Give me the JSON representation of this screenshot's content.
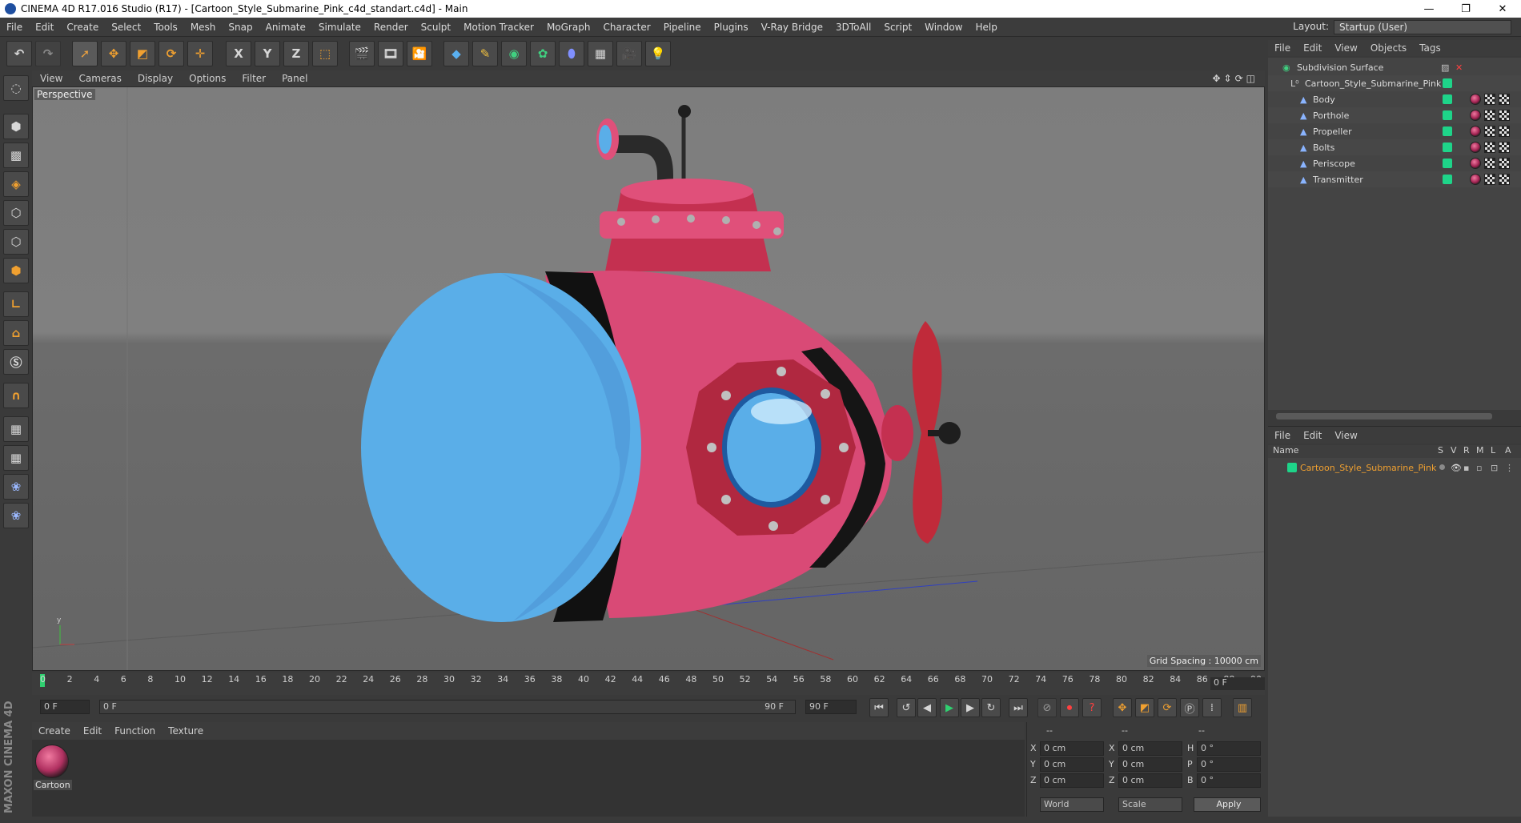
{
  "window": {
    "title": "CINEMA 4D R17.016 Studio (R17) - [Cartoon_Style_Submarine_Pink_c4d_standart.c4d] - Main",
    "minimize": "—",
    "maximize": "❐",
    "close": "✕"
  },
  "menubar": [
    "File",
    "Edit",
    "Create",
    "Select",
    "Tools",
    "Mesh",
    "Snap",
    "Animate",
    "Simulate",
    "Render",
    "Sculpt",
    "Motion Tracker",
    "MoGraph",
    "Character",
    "Pipeline",
    "Plugins",
    "V-Ray Bridge",
    "3DToAll",
    "Script",
    "Window",
    "Help"
  ],
  "layout": {
    "label": "Layout:",
    "value": "Startup (User)"
  },
  "toolbar": {
    "axis_x": "X",
    "axis_y": "Y",
    "axis_z": "Z"
  },
  "viewport": {
    "menu": [
      "View",
      "Cameras",
      "Display",
      "Options",
      "Filter",
      "Panel"
    ],
    "label": "Perspective",
    "grid_spacing": "Grid Spacing : 10000 cm"
  },
  "timeline": {
    "ticks": [
      "0",
      "2",
      "4",
      "6",
      "8",
      "10",
      "12",
      "14",
      "16",
      "18",
      "20",
      "22",
      "24",
      "26",
      "28",
      "30",
      "32",
      "34",
      "36",
      "38",
      "40",
      "42",
      "44",
      "46",
      "48",
      "50",
      "52",
      "54",
      "56",
      "58",
      "60",
      "62",
      "64",
      "66",
      "68",
      "70",
      "72",
      "74",
      "76",
      "78",
      "80",
      "82",
      "84",
      "86",
      "88",
      "90"
    ],
    "current_frame": "0 F",
    "start_field": "0 F",
    "range_start": "0 F",
    "range_end": "90 F",
    "end_field": "90 F"
  },
  "material_manager": {
    "menu": [
      "Create",
      "Edit",
      "Function",
      "Texture"
    ],
    "material_name": "Cartoon"
  },
  "brand": "MAXON CINEMA 4D",
  "coordinates": {
    "header1": "--",
    "header2": "--",
    "header3": "--",
    "rows": [
      {
        "a": "X",
        "av": "0 cm",
        "b": "X",
        "bv": "0 cm",
        "c": "H",
        "cv": "0 °"
      },
      {
        "a": "Y",
        "av": "0 cm",
        "b": "Y",
        "bv": "0 cm",
        "c": "P",
        "cv": "0 °"
      },
      {
        "a": "Z",
        "av": "0 cm",
        "b": "Z",
        "bv": "0 cm",
        "c": "B",
        "cv": "0 °"
      }
    ],
    "world": "World",
    "scale": "Scale",
    "apply": "Apply"
  },
  "object_manager": {
    "menu": [
      "File",
      "Edit",
      "View",
      "Objects",
      "Tags"
    ],
    "objects": [
      {
        "name": "Subdivision Surface",
        "level": 0
      },
      {
        "name": "Cartoon_Style_Submarine_Pink",
        "level": 1
      },
      {
        "name": "Body",
        "level": 2
      },
      {
        "name": "Porthole",
        "level": 2
      },
      {
        "name": "Propeller",
        "level": 2
      },
      {
        "name": "Bolts",
        "level": 2
      },
      {
        "name": "Periscope",
        "level": 2
      },
      {
        "name": "Transmitter",
        "level": 2
      }
    ]
  },
  "layer_manager": {
    "menu": [
      "File",
      "Edit",
      "View"
    ],
    "columns": [
      "Name",
      "S",
      "V",
      "R",
      "M",
      "L",
      "A"
    ],
    "layers": [
      {
        "name": "Cartoon_Style_Submarine_Pink"
      }
    ]
  },
  "colors": {
    "accent_green": "#1ed489",
    "layer_name": "#f0a030",
    "submarine_pink": "#e0507a",
    "submarine_blue": "#5aaee8"
  }
}
